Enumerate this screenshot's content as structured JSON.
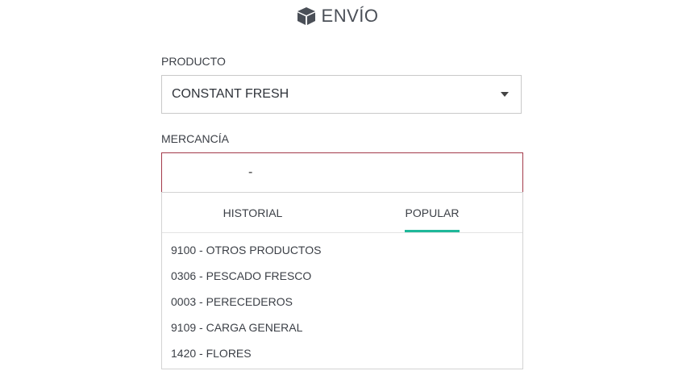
{
  "header": {
    "title": "ENVÍO",
    "icon": "box-icon"
  },
  "producto": {
    "label": "PRODUCTO",
    "selected": "CONSTANT FRESH"
  },
  "mercancia": {
    "label": "MERCANCÍA",
    "value": "-",
    "tabs": [
      {
        "label": "HISTORIAL",
        "active": false
      },
      {
        "label": "POPULAR",
        "active": true
      }
    ],
    "options": [
      "9100 - OTROS PRODUCTOS",
      "0306 - PESCADO FRESCO",
      "0003 - PERECEDEROS",
      "9109 - CARGA GENERAL",
      "1420 - FLORES"
    ]
  },
  "colors": {
    "accent": "#1fb89a",
    "error_border": "#a33a4a",
    "text": "#3b3f46"
  }
}
